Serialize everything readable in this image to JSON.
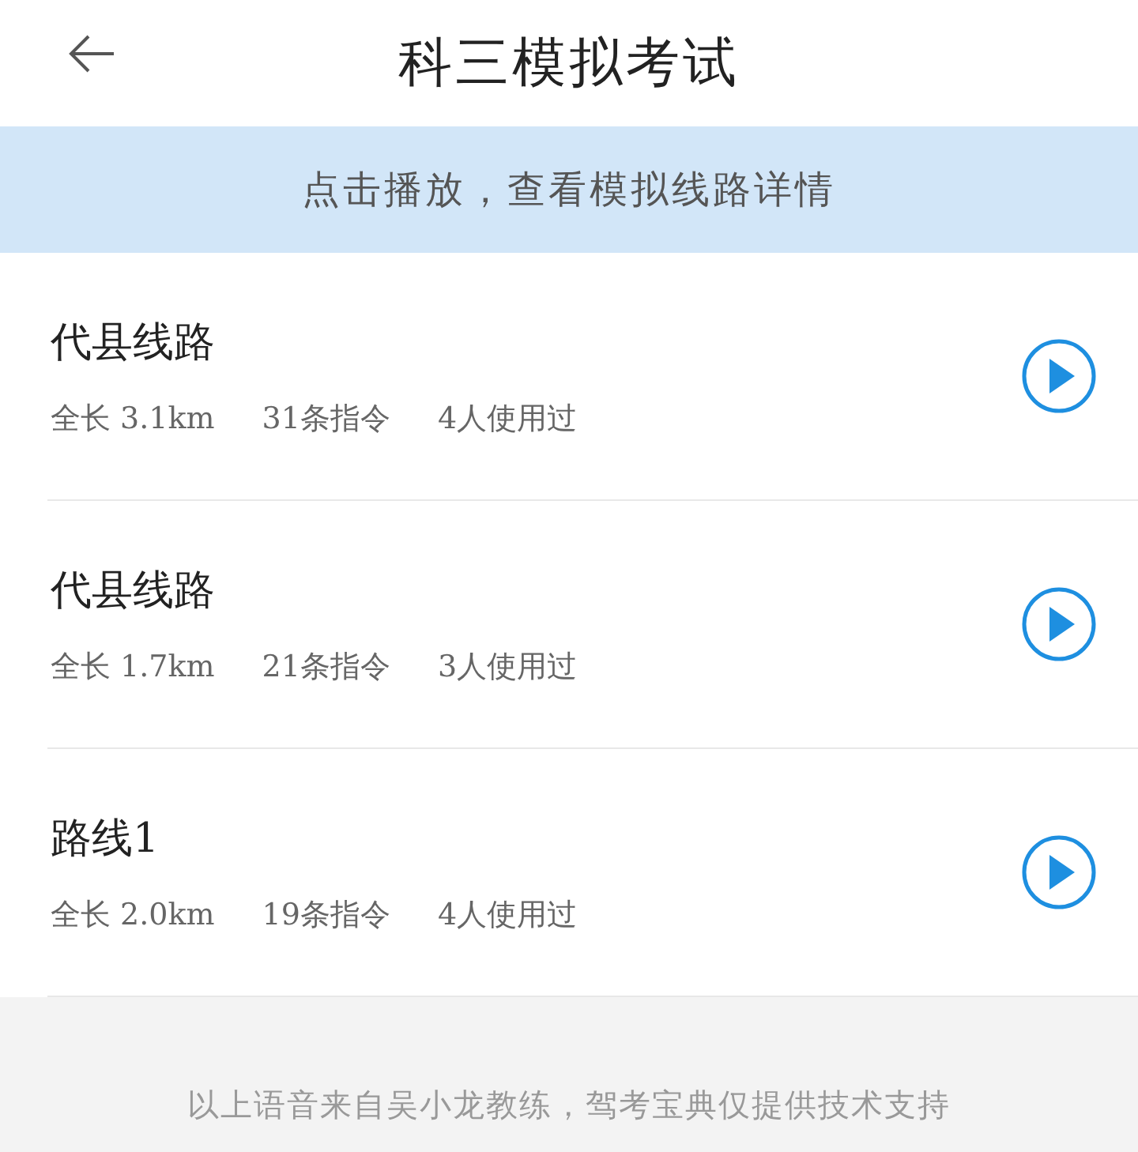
{
  "header": {
    "title": "科三模拟考试"
  },
  "banner": {
    "text": "点击播放，查看模拟线路详情"
  },
  "routes": [
    {
      "name": "代县线路",
      "length": "全长 3.1km",
      "instructions": "31条指令",
      "users": "4人使用过"
    },
    {
      "name": "代县线路",
      "length": "全长 1.7km",
      "instructions": "21条指令",
      "users": "3人使用过"
    },
    {
      "name": "路线1",
      "length": "全长 2.0km",
      "instructions": "19条指令",
      "users": "4人使用过"
    }
  ],
  "footer": {
    "text": "以上语音来自吴小龙教练，驾考宝典仅提供技术支持"
  }
}
